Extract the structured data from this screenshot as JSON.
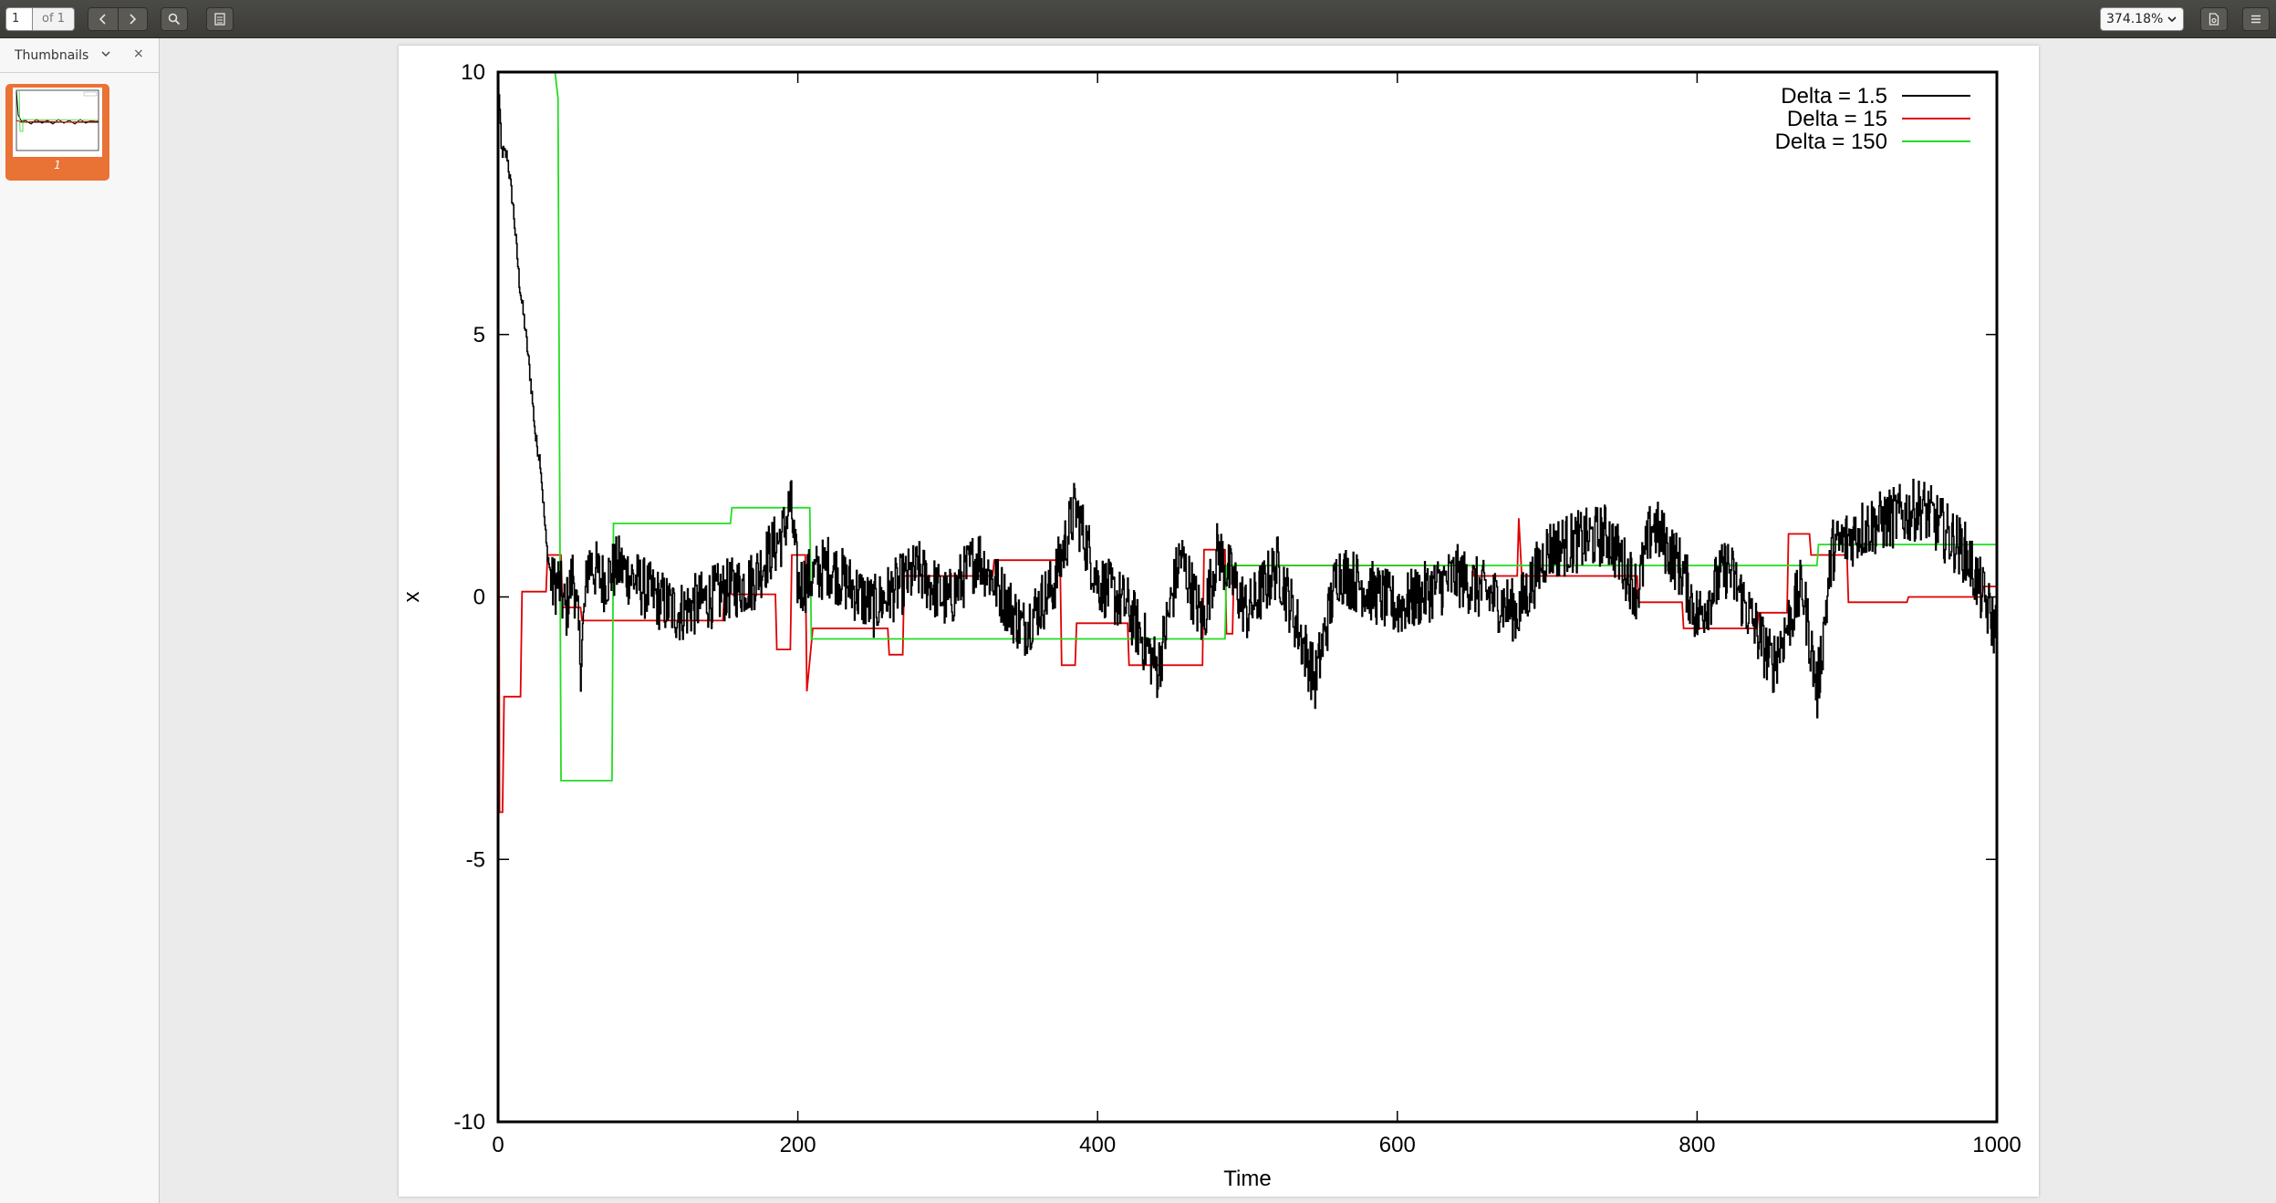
{
  "toolbar": {
    "page_value": "1",
    "page_of": "of 1",
    "zoom": "374.18%",
    "icons": {
      "prev": "chevron-left-icon",
      "next": "chevron-right-icon",
      "search": "search-icon",
      "sidebar": "sidebar-toggle-icon",
      "document": "document-icon",
      "menu": "hamburger-menu-icon"
    }
  },
  "sidebar": {
    "title": "Thumbnails",
    "close": "×",
    "thumbnail_label": "1",
    "accent": "#e97235"
  },
  "chart_data": {
    "type": "line",
    "title": "",
    "xlabel": "Time",
    "ylabel": "x",
    "xlim": [
      0,
      1000
    ],
    "ylim": [
      -10,
      10
    ],
    "xticks": [
      "0",
      "200",
      "400",
      "600",
      "800",
      "1000"
    ],
    "yticks": [
      "10",
      "5",
      "0",
      "-5",
      "-10"
    ],
    "grid": false,
    "legend_position": "top-right",
    "series": [
      {
        "name": "Delta = 1.5",
        "color": "#000000",
        "noise": 0.6,
        "points": [
          [
            0,
            10
          ],
          [
            2,
            8.5
          ],
          [
            6,
            8.4
          ],
          [
            10,
            7.4
          ],
          [
            14,
            6
          ],
          [
            18,
            5.1
          ],
          [
            22,
            4
          ],
          [
            25,
            3
          ],
          [
            28,
            2.6
          ],
          [
            32,
            1
          ],
          [
            36,
            0.2
          ],
          [
            40,
            0.3
          ],
          [
            45,
            -0.3
          ],
          [
            50,
            0.5
          ],
          [
            55,
            -1.2
          ],
          [
            60,
            0.7
          ],
          [
            70,
            0.3
          ],
          [
            80,
            0.6
          ],
          [
            100,
            0.1
          ],
          [
            120,
            -0.3
          ],
          [
            150,
            0.1
          ],
          [
            170,
            0.3
          ],
          [
            180,
            0.8
          ],
          [
            190,
            1.2
          ],
          [
            195,
            1.8
          ],
          [
            200,
            0.2
          ],
          [
            220,
            0.6
          ],
          [
            250,
            -0.2
          ],
          [
            280,
            0.5
          ],
          [
            300,
            -0.1
          ],
          [
            320,
            0.8
          ],
          [
            350,
            -0.6
          ],
          [
            370,
            0.2
          ],
          [
            385,
            1.7
          ],
          [
            400,
            0.3
          ],
          [
            420,
            -0.2
          ],
          [
            440,
            -1.4
          ],
          [
            455,
            0.8
          ],
          [
            470,
            -0.5
          ],
          [
            480,
            0.9
          ],
          [
            500,
            -0.3
          ],
          [
            520,
            0.6
          ],
          [
            545,
            -1.6
          ],
          [
            560,
            0.5
          ],
          [
            600,
            -0.2
          ],
          [
            640,
            0.4
          ],
          [
            680,
            -0.3
          ],
          [
            700,
            0.9
          ],
          [
            740,
            1.2
          ],
          [
            760,
            0.1
          ],
          [
            770,
            1.4
          ],
          [
            790,
            0.5
          ],
          [
            800,
            -0.4
          ],
          [
            820,
            0.6
          ],
          [
            850,
            -1.3
          ],
          [
            870,
            0.2
          ],
          [
            880,
            -1.8
          ],
          [
            890,
            0.9
          ],
          [
            910,
            1.3
          ],
          [
            950,
            1.7
          ],
          [
            980,
            0.8
          ],
          [
            1000,
            -0.7
          ]
        ]
      },
      {
        "name": "Delta = 15",
        "color": "#e00000",
        "noise": 0,
        "points": [
          [
            0,
            10
          ],
          [
            1,
            -4.1
          ],
          [
            3,
            -4.1
          ],
          [
            4,
            -1.9
          ],
          [
            15,
            -1.9
          ],
          [
            16,
            0.1
          ],
          [
            32,
            0.1
          ],
          [
            33,
            0.8
          ],
          [
            42,
            0.8
          ],
          [
            43,
            -0.2
          ],
          [
            55,
            -0.2
          ],
          [
            56,
            -0.45
          ],
          [
            150,
            -0.45
          ],
          [
            151,
            0.05
          ],
          [
            185,
            0.05
          ],
          [
            186,
            -1.0
          ],
          [
            195,
            -1.0
          ],
          [
            196,
            0.8
          ],
          [
            205,
            0.8
          ],
          [
            206,
            -1.8
          ],
          [
            210,
            -0.6
          ],
          [
            260,
            -0.6
          ],
          [
            261,
            -1.1
          ],
          [
            270,
            -1.1
          ],
          [
            271,
            0.4
          ],
          [
            330,
            0.4
          ],
          [
            331,
            0.7
          ],
          [
            375,
            0.7
          ],
          [
            376,
            -1.3
          ],
          [
            385,
            -1.3
          ],
          [
            386,
            -0.5
          ],
          [
            420,
            -0.5
          ],
          [
            421,
            -1.3
          ],
          [
            470,
            -1.3
          ],
          [
            471,
            0.9
          ],
          [
            485,
            0.9
          ],
          [
            486,
            -0.7
          ],
          [
            490,
            -0.7
          ],
          [
            491,
            0.6
          ],
          [
            650,
            0.6
          ],
          [
            651,
            0.4
          ],
          [
            680,
            0.4
          ],
          [
            681,
            1.5
          ],
          [
            683,
            0.4
          ],
          [
            760,
            0.4
          ],
          [
            761,
            -0.1
          ],
          [
            790,
            -0.1
          ],
          [
            791,
            -0.6
          ],
          [
            840,
            -0.6
          ],
          [
            841,
            -0.3
          ],
          [
            860,
            -0.3
          ],
          [
            861,
            1.2
          ],
          [
            875,
            1.2
          ],
          [
            876,
            0.8
          ],
          [
            900,
            0.8
          ],
          [
            901,
            -0.1
          ],
          [
            940,
            -0.1
          ],
          [
            941,
            0
          ],
          [
            990,
            0
          ],
          [
            991,
            0.2
          ],
          [
            1000,
            0.2
          ]
        ]
      },
      {
        "name": "Delta = 150",
        "color": "#22dd22",
        "noise": 0,
        "points": [
          [
            38,
            10
          ],
          [
            40,
            9.5
          ],
          [
            42,
            -3.5
          ],
          [
            76,
            -3.5
          ],
          [
            77,
            1.4
          ],
          [
            155,
            1.4
          ],
          [
            156,
            1.7
          ],
          [
            208,
            1.7
          ],
          [
            209,
            -0.8
          ],
          [
            485,
            -0.8
          ],
          [
            486,
            0.6
          ],
          [
            880,
            0.6
          ],
          [
            881,
            1.0
          ],
          [
            1000,
            1.0
          ]
        ]
      }
    ]
  }
}
